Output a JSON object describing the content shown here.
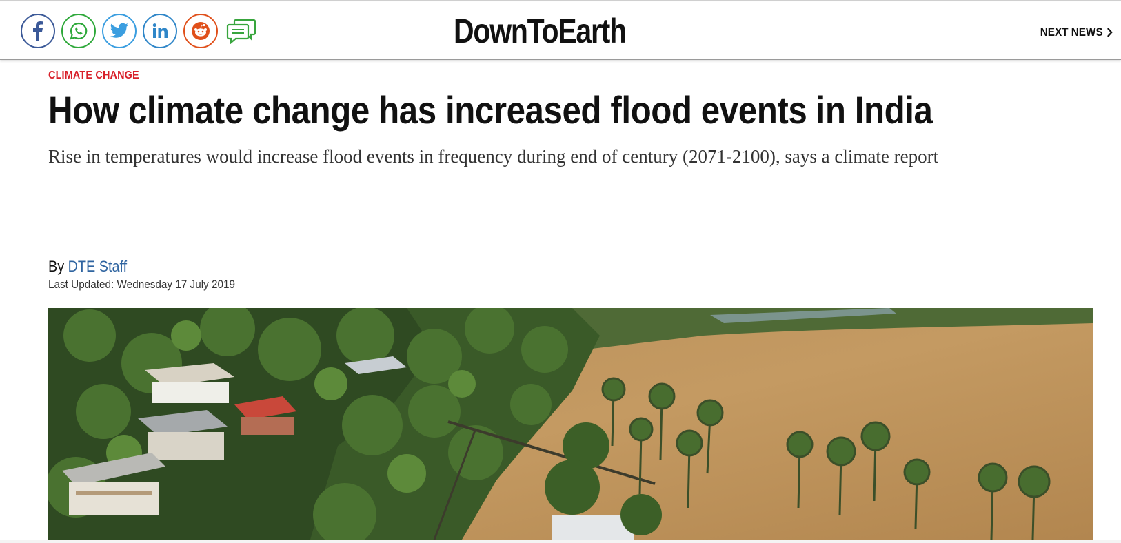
{
  "header": {
    "logo": "DownToEarth",
    "next_news_label": "NEXT NEWS",
    "share_buttons": [
      {
        "name": "facebook",
        "icon": "facebook-icon",
        "color": "#3b5998"
      },
      {
        "name": "whatsapp",
        "icon": "whatsapp-icon",
        "color": "#2ea83a"
      },
      {
        "name": "twitter",
        "icon": "twitter-icon",
        "color": "#3b9ee0"
      },
      {
        "name": "linkedin",
        "icon": "linkedin-icon",
        "color": "#2f86c8"
      },
      {
        "name": "reddit",
        "icon": "reddit-icon",
        "color": "#e0501b"
      }
    ],
    "comment_icon": "comment-icon"
  },
  "article": {
    "category": "CLIMATE CHANGE",
    "title": "How climate change has increased flood events in India",
    "subtitle": "Rise in temperatures would increase flood events in frequency during end of century (2071-2100), says a climate report",
    "byline_prefix": "By",
    "author": "DTE Staff",
    "last_updated": "Last Updated: Wednesday 17 July 2019"
  },
  "colors": {
    "accent_red": "#d8202a",
    "author_link": "#2f64a0",
    "comment_green": "#38a53d"
  }
}
